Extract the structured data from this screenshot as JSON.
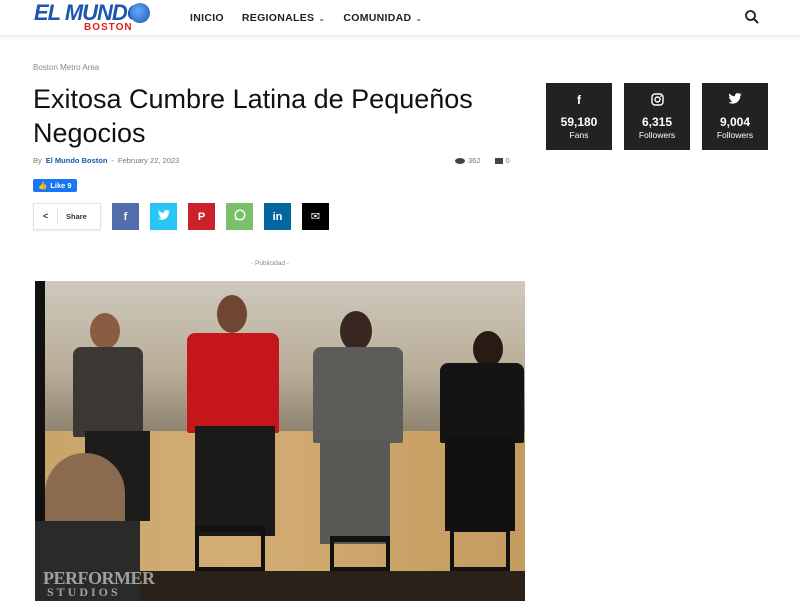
{
  "header": {
    "logo_main": "EL MUNDO",
    "logo_sub": "BOSTON",
    "nav": [
      {
        "label": "INICIO"
      },
      {
        "label": "REGIONALES"
      },
      {
        "label": "COMUNIDAD"
      }
    ],
    "search_icon": "search-icon"
  },
  "article": {
    "breadcrumb": "Boston Metro Area",
    "title": "Exitosa Cumbre Latina de Pequeños Negocios",
    "by": "By",
    "author": "El Mundo Boston",
    "separator": "-",
    "date": "February 22, 2023",
    "views": "362",
    "comments": "0",
    "fb_like": "Like 9",
    "share_label": "Share",
    "share_buttons": [
      {
        "name": "facebook",
        "glyph": "f",
        "color": "#516eab"
      },
      {
        "name": "twitter",
        "glyph": "t",
        "color": "#29c5f6"
      },
      {
        "name": "pinterest",
        "glyph": "p",
        "color": "#ca212a"
      },
      {
        "name": "whatsapp",
        "glyph": "w",
        "color": "#7bbf6a"
      },
      {
        "name": "linkedin",
        "glyph": "in",
        "color": "#0266a0"
      },
      {
        "name": "email",
        "glyph": "✉",
        "color": "#000000"
      }
    ],
    "publicidad": "- Publicidad -",
    "photo_watermark_line1": "PERFORMER",
    "photo_watermark_line2": "STUDIOS"
  },
  "social": [
    {
      "icon": "facebook-icon",
      "glyph": "f",
      "count": "59,180",
      "label": "Fans"
    },
    {
      "icon": "instagram-icon",
      "glyph": "◎",
      "count": "6,315",
      "label": "Followers"
    },
    {
      "icon": "twitter-icon",
      "glyph": "t",
      "count": "9,004",
      "label": "Followers"
    }
  ],
  "colors": {
    "brand": "#1b57b0",
    "accent_red": "#dd2222",
    "social_bg": "#222222"
  }
}
